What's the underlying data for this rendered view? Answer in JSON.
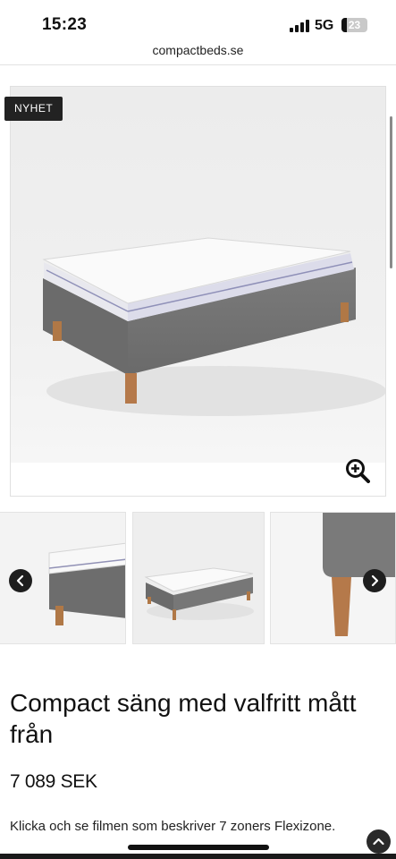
{
  "status": {
    "time": "15:23",
    "network": "5G",
    "battery": "23"
  },
  "browser": {
    "url": "compactbeds.se"
  },
  "product": {
    "badge": "NYHET",
    "title": "Compact säng med valfritt mått från",
    "price": "7 089 SEK",
    "description": "Klicka och se filmen som beskriver 7 zoners Flexizone."
  },
  "icons": {
    "zoom": "zoom-in-icon",
    "prev": "chevron-left-icon",
    "next": "chevron-right-icon",
    "scroll_top": "chevron-up-icon"
  },
  "colors": {
    "badge_bg": "#222222",
    "accent": "#111111"
  }
}
